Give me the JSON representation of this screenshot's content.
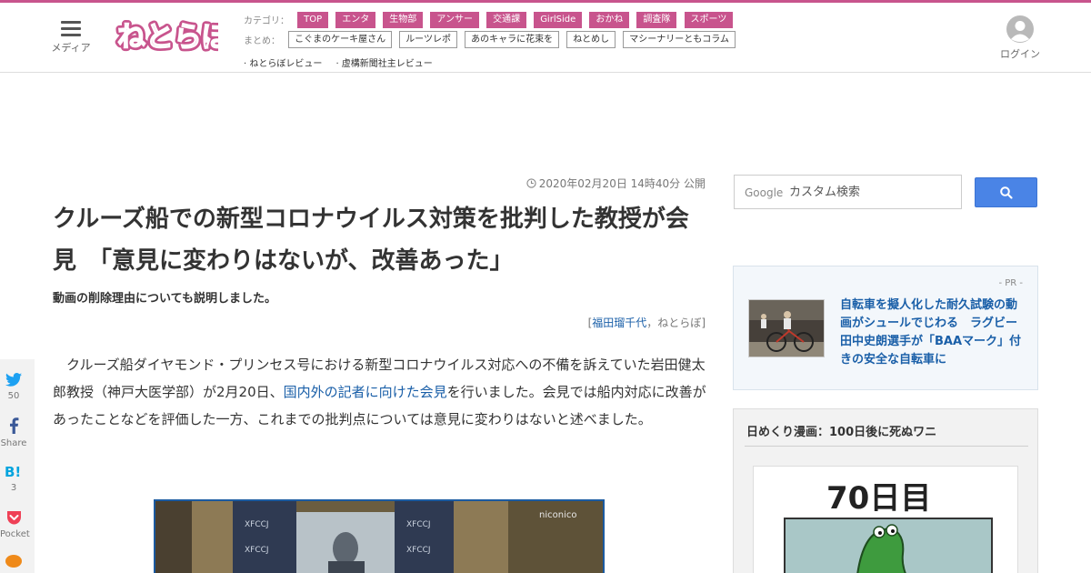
{
  "header": {
    "menu_label": "メディア",
    "logo_text": "ねとらぼ",
    "categories_label": "カテゴリ：",
    "categories": [
      "TOP",
      "エンタ",
      "生物部",
      "アンサー",
      "交通課",
      "GirlSide",
      "おかね",
      "調査隊",
      "スポーツ"
    ],
    "summary_label": "まとめ：",
    "summaries": [
      "こぐまのケーキ屋さん",
      "ルーツレポ",
      "あのキャラに花束を",
      "ねとめし",
      "マシーナリーともコラム"
    ],
    "reviews": [
      "· ねとらぼレビュー",
      "· 虚構新聞社主レビュー"
    ],
    "login_label": "ログイン"
  },
  "article": {
    "timestamp": "2020年02月20日 14時40分 公開",
    "title": "クルーズ船での新型コロナウイルス対策を批判した教授が会見　「意見に変わりはないが、改善あった」",
    "subtitle": "動画の削除理由についても説明しました。",
    "byline_open": "[",
    "byline_author": "福田瑠千代",
    "byline_sep": "，",
    "byline_outlet": "ねとらぼ",
    "byline_close": "]",
    "body_1": "　クルーズ船ダイヤモンド・プリンセス号における新型コロナウイルス対応への不備を訴えていた岩田健太郎教授（神戸大医学部）が2月20日、",
    "body_link": "国内外の記者に向けた会見",
    "body_2": "を行いました。会見では船内対応に改善があったことなどを評価した一方、これまでの批判点については意見に変わりはないと述べました。",
    "video_watermark": "niconico"
  },
  "share": [
    {
      "icon": "twitter-icon",
      "count": "50"
    },
    {
      "icon": "facebook-icon",
      "count": "Share"
    },
    {
      "icon": "hatena-icon",
      "count": "3"
    },
    {
      "icon": "pocket-icon",
      "count": "Pocket"
    },
    {
      "icon": "line-icon",
      "count": ""
    }
  ],
  "sidebar": {
    "search_brand": "Google",
    "search_placeholder": "カスタム検索",
    "pr_label": "- PR -",
    "pr_link": "自転車を擬人化した耐久試験の動画がシュールでじわる　ラグビー田中史朗選手が「BAAマーク」付きの安全な自転車に",
    "manga_title": "日めくり漫画：100日後に死ぬワニ",
    "manga_day": "70日目"
  },
  "colors": {
    "brand": "#c8548d",
    "link": "#1a5fa8",
    "search_button": "#4a84e6"
  }
}
